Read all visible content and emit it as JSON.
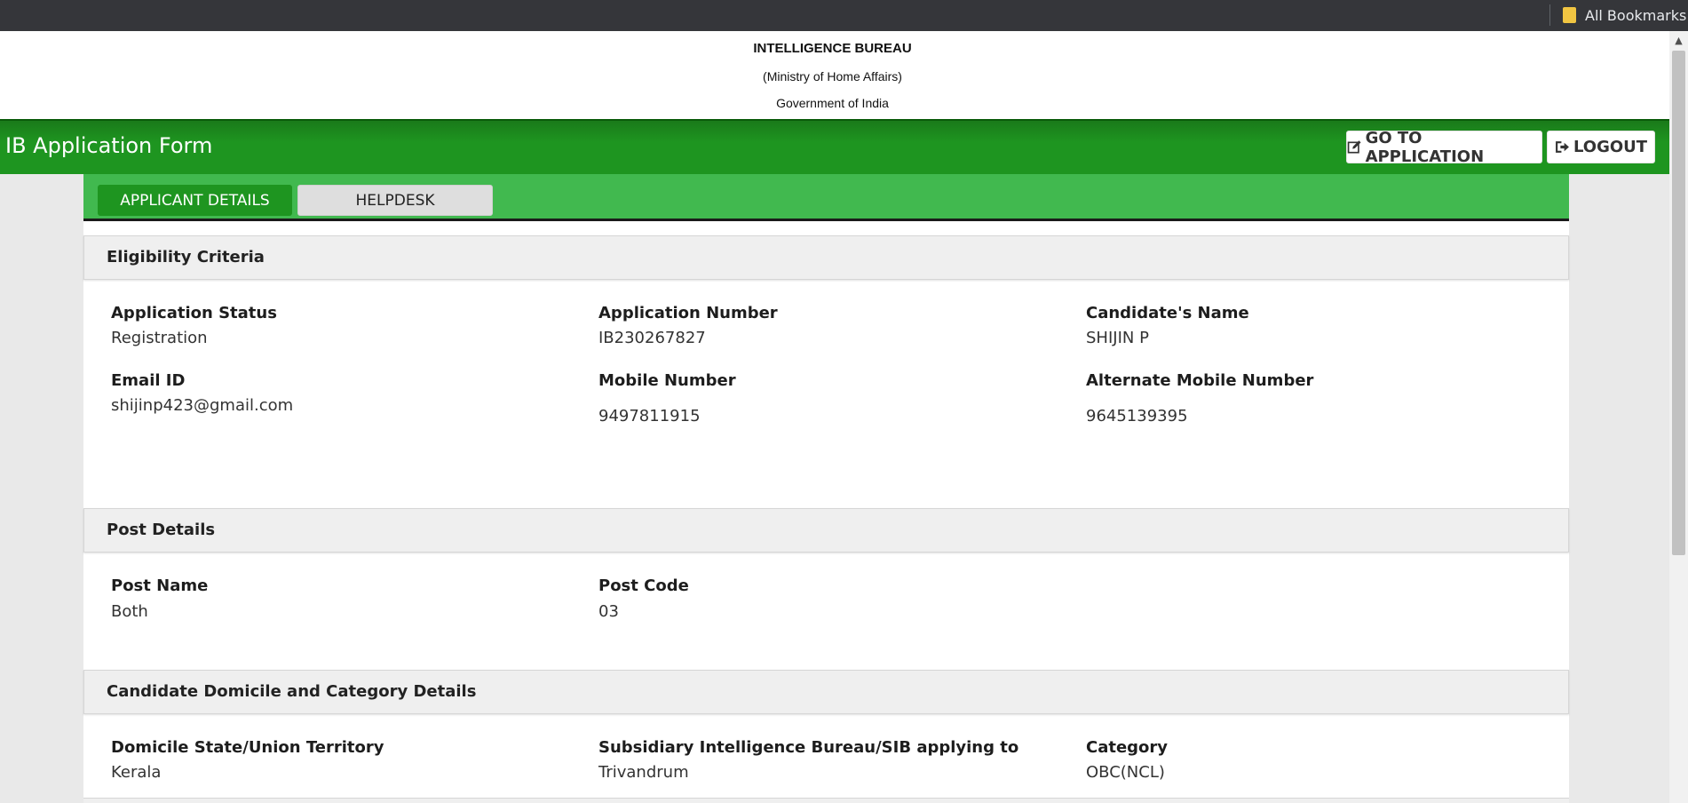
{
  "browser": {
    "bookmarks_label": "All Bookmarks"
  },
  "header": {
    "org_name": "INTELLIGENCE BUREAU",
    "ministry": "(Ministry of Home Affairs)",
    "government": "Government of India"
  },
  "navbar": {
    "title": "IB Application Form",
    "go_to_application": "GO TO APPLICATION",
    "logout": "LOGOUT"
  },
  "tabs": {
    "applicant_details": "APPLICANT DETAILS",
    "helpdesk": "HELPDESK"
  },
  "eligibility": {
    "heading": "Eligibility Criteria",
    "application_status_label": "Application Status",
    "application_status": "Registration",
    "application_number_label": "Application Number",
    "application_number": "IB230267827",
    "candidate_name_label": "Candidate's Name",
    "candidate_name": "SHIJIN P",
    "email_label": "Email ID",
    "email": "shijinp423@gmail.com",
    "mobile_label": "Mobile Number",
    "mobile": "9497811915",
    "alt_mobile_label": "Alternate Mobile Number",
    "alt_mobile": "9645139395"
  },
  "post": {
    "heading": "Post Details",
    "post_name_label": "Post Name",
    "post_name": "Both",
    "post_code_label": "Post Code",
    "post_code": "03"
  },
  "domicile": {
    "heading": "Candidate Domicile and Category Details",
    "state_label": "Domicile State/Union Territory",
    "state": "Kerala",
    "sib_label": "Subsidiary Intelligence Bureau/SIB applying to",
    "sib": "Trivandrum",
    "category_label": "Category",
    "category": "OBC(NCL)"
  }
}
